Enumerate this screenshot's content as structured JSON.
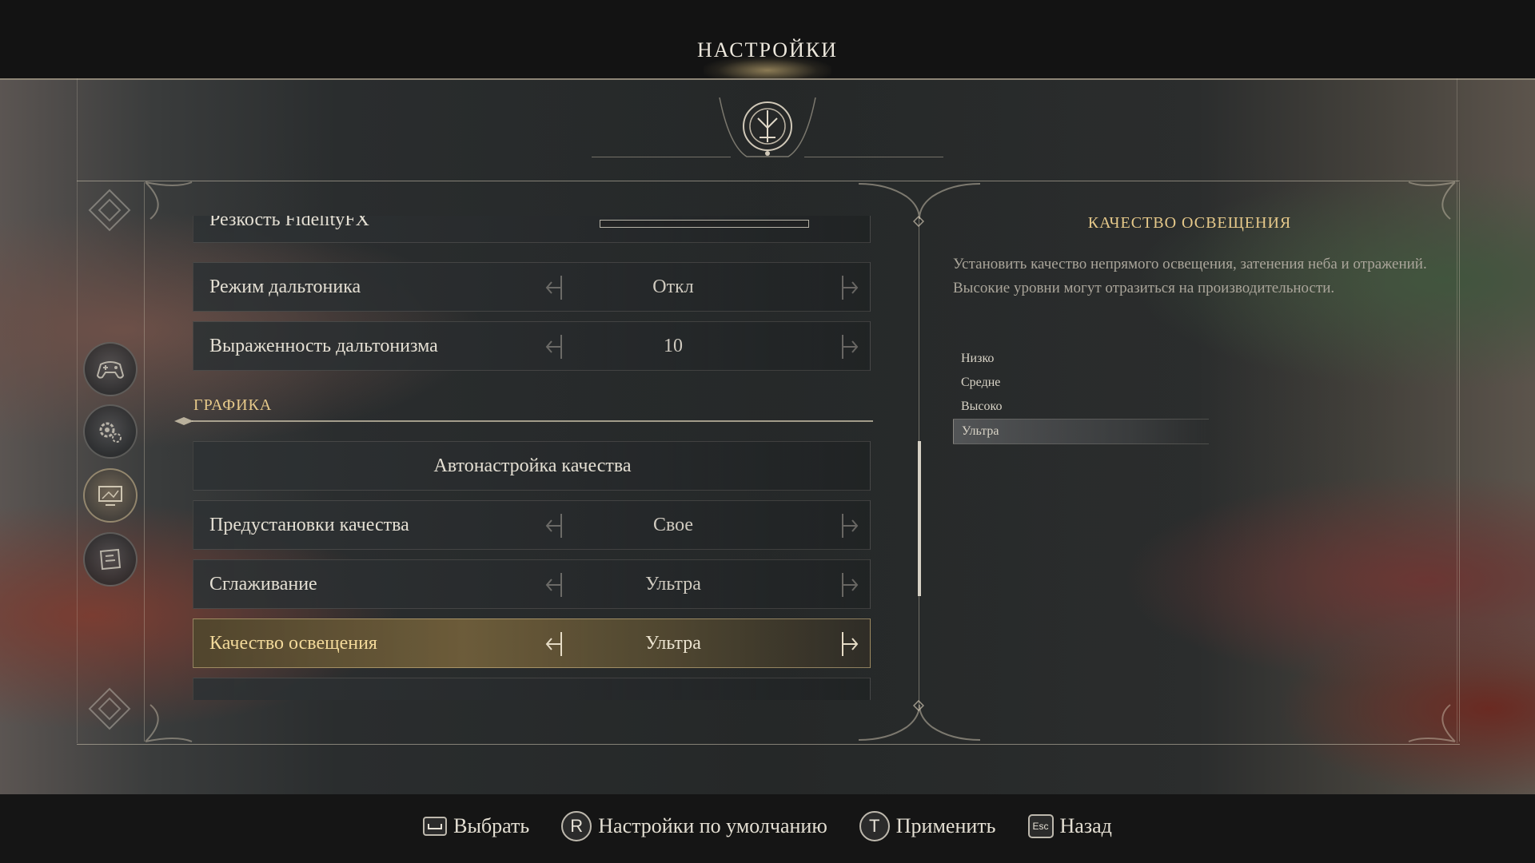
{
  "header": {
    "title": "НАСТРОЙКИ"
  },
  "nav": {
    "icons": [
      "diamond-emblem-icon",
      "gamepad-icon",
      "gear-icon",
      "monitor-icon",
      "map-icon",
      "diamond-emblem-icon"
    ],
    "active_index": 3
  },
  "settings": {
    "rows_top": [
      {
        "label": "Резкость FidelityFX",
        "type": "slider"
      },
      {
        "label": "Режим дальтоника",
        "value": "Откл"
      },
      {
        "label": "Выраженность дальтонизма",
        "value": "10"
      }
    ],
    "section_header": "ГРАФИКА",
    "auto_button": "Автонастройка качества",
    "rows_graphics": [
      {
        "label": "Предустановки качества",
        "value": "Свое"
      },
      {
        "label": "Сглаживание",
        "value": "Ультра"
      },
      {
        "label": "Качество освещения",
        "value": "Ультра",
        "selected": true
      }
    ]
  },
  "info": {
    "title": "КАЧЕСТВО ОСВЕЩЕНИЯ",
    "description": "Установить качество непрямого освещения, затенения неба и отражений. Высокие уровни могут отразиться на производительности.",
    "options": [
      "Низко",
      "Средне",
      "Высоко",
      "Ультра"
    ],
    "selected_option": "Ультра"
  },
  "controls": [
    {
      "key": "space-key-icon",
      "label": "Выбрать"
    },
    {
      "key": "R",
      "label": "Настройки по умолчанию"
    },
    {
      "key": "T",
      "label": "Применить"
    },
    {
      "key": "Esc",
      "label": "Назад"
    }
  ],
  "colors": {
    "accent_gold": "#e6c98a",
    "selected_label": "#f2d99a",
    "text": "#e4dfd3"
  }
}
